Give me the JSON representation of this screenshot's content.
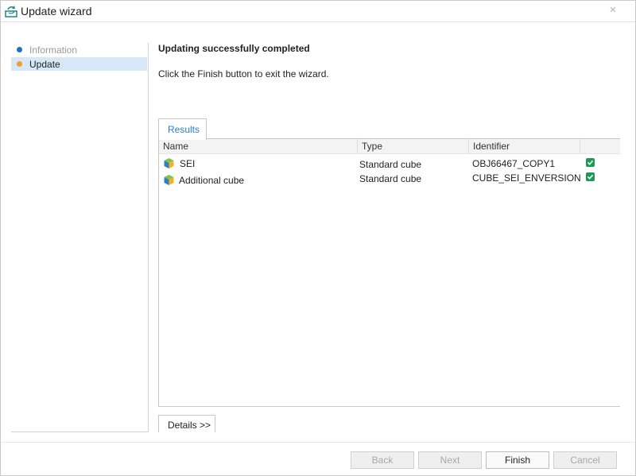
{
  "window": {
    "title": "Update wizard",
    "close_label": "×"
  },
  "steps": [
    {
      "label": "Information",
      "state": "done"
    },
    {
      "label": "Update",
      "state": "current"
    }
  ],
  "message": {
    "title": "Updating successfully completed",
    "text": "Click the Finish button to exit the wizard."
  },
  "tab": {
    "label": "Results"
  },
  "table": {
    "headers": {
      "name": "Name",
      "type": "Type",
      "identifier": "Identifier"
    },
    "rows": [
      {
        "name": "SEI",
        "type": "Standard cube",
        "identifier": "OBJ66467_COPY1",
        "status": "success"
      },
      {
        "name": "Additional cube",
        "type": "Standard cube",
        "identifier": "CUBE_SEI_ENVERSION",
        "status": "success"
      }
    ]
  },
  "details_button": {
    "label": "Details >>"
  },
  "footer": {
    "back_label": "Back",
    "next_label": "Next",
    "finish_label": "Finish",
    "cancel_label": "Cancel"
  },
  "colors": {
    "accent": "#2a7dc9",
    "step_done_dot": "#1f6fc6",
    "step_current_dot": "#f0a030",
    "selected_row": "#d6e7f5",
    "success": "#1a9b54"
  },
  "icons": {
    "title": "refresh-update-icon",
    "cube": "cube-icon",
    "status": "check-icon",
    "close": "close-icon"
  }
}
